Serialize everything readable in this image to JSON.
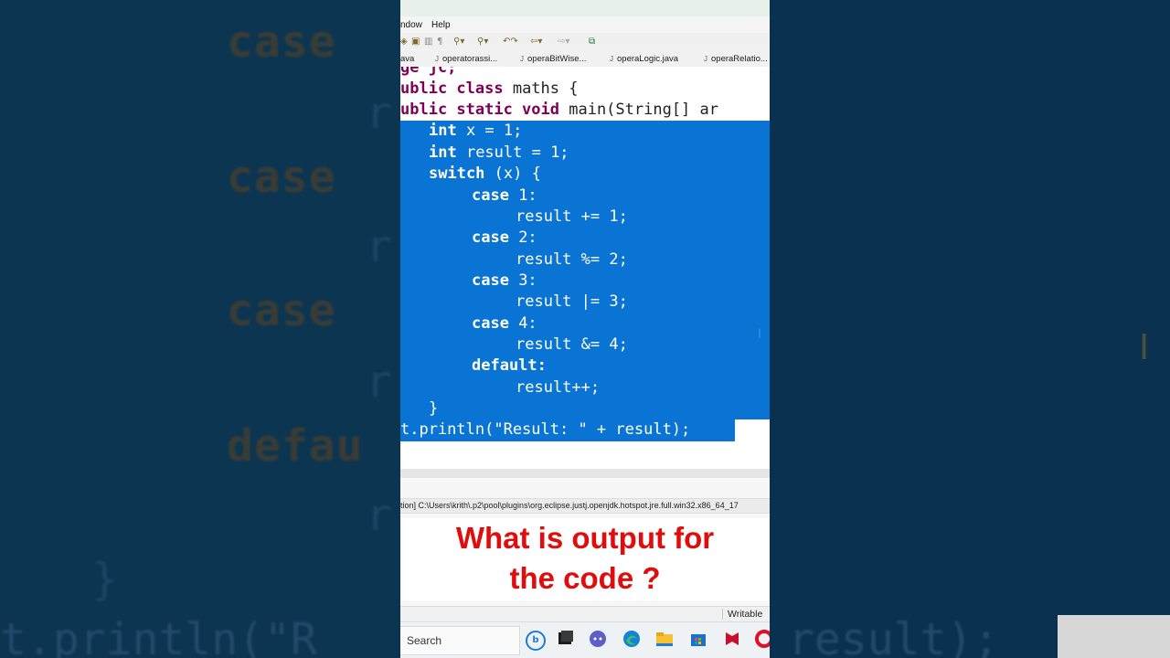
{
  "background": {
    "left_words": [
      "case",
      "case",
      "case",
      "defau"
    ],
    "left_faint": [
      "r",
      "r",
      "r",
      "r",
      "}"
    ],
    "bottom_line": "t.println(\"R",
    "right_bottom_line": "result);"
  },
  "menu": {
    "window": "ndow",
    "help": "Help"
  },
  "tabs": [
    {
      "label": "ava"
    },
    {
      "label": "operatorassi..."
    },
    {
      "label": "operaBitWise..."
    },
    {
      "label": "operaLogic.java"
    },
    {
      "label": "operaRelatio..."
    }
  ],
  "code": {
    "line0": "ge jc;",
    "line1_kw": "ublic class",
    "line1_rest": " maths {",
    "line2_kw": "ublic static void",
    "line2_rest": " main(String[] ar",
    "line3_kw": "int",
    "line3_rest": " x = 1;",
    "line4_kw": "int",
    "line4_rest": " result = 1;",
    "line5_kw": "switch",
    "line5_rest": " (x) {",
    "case1_kw": "case",
    "case1_rest": " 1:",
    "stmt1": "result += 1;",
    "case2_kw": "case",
    "case2_rest": " 2:",
    "stmt2": "result %= 2;",
    "case3_kw": "case",
    "case3_rest": " 3:",
    "stmt3": "result |= 3;",
    "case4_kw": "case",
    "case4_rest": " 4:",
    "stmt4": "result &= 4;",
    "default_kw": "default:",
    "stmt5": "result++;",
    "close_brace": "}",
    "println": "t.println(\"Result: \" + result);"
  },
  "console": {
    "path": "tion] C:\\Users\\krith\\.p2\\pool\\plugins\\org.eclipse.justj.openjdk.hotspot.jre.full.win32.x86_64_17"
  },
  "question": {
    "line1": "What is output for",
    "line2": "the code ?"
  },
  "status": {
    "writable": "Writable"
  },
  "taskbar": {
    "search": "Search"
  },
  "colors": {
    "selection": "#0a74d4",
    "keyword": "#7f0055",
    "question": "#e00d0d"
  }
}
